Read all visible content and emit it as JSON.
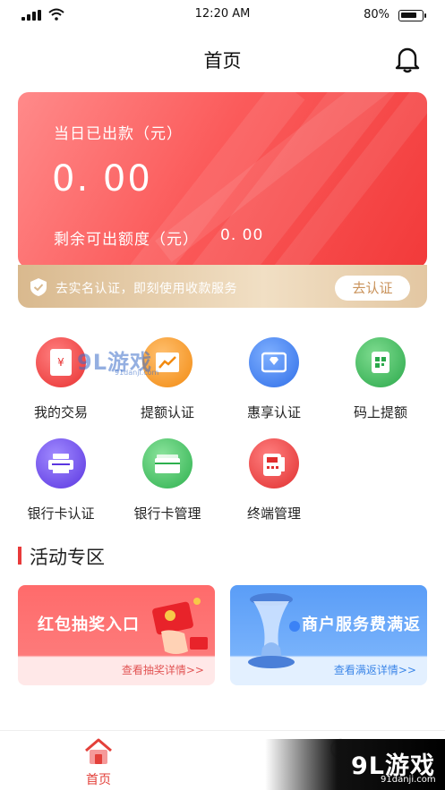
{
  "status_bar": {
    "time": "12:20 AM",
    "battery": "80%",
    "battery_level": 0.8
  },
  "nav": {
    "title": "首页"
  },
  "card": {
    "today_label": "当日已出款（元）",
    "today_amount": "0. 00",
    "remaining_label": "剩余可出额度（元）",
    "remaining_amount": "0. 00",
    "auth_text": "去实名认证，即刻使用收款服务",
    "auth_button": "去认证"
  },
  "grid": [
    {
      "label": "我的交易",
      "icon": "transaction-icon",
      "color": "#f24a4a"
    },
    {
      "label": "提额认证",
      "icon": "chart-up-icon",
      "color": "#f7941e"
    },
    {
      "label": "惠享认证",
      "icon": "diamond-badge-icon",
      "color": "#3b7cf2"
    },
    {
      "label": "码上提额",
      "icon": "qr-code-icon",
      "color": "#36b555"
    },
    {
      "label": "银行卡认证",
      "icon": "card-reader-icon",
      "color": "#6a47e6"
    },
    {
      "label": "银行卡管理",
      "icon": "bank-card-icon",
      "color": "#3cbd5c"
    },
    {
      "label": "终端管理",
      "icon": "pos-terminal-icon",
      "color": "#ec3d3d"
    }
  ],
  "section": {
    "title": "活动专区"
  },
  "activities": [
    {
      "title": "红包抽奖入口",
      "link": "查看抽奖详情>>"
    },
    {
      "title": "商户服务费满返",
      "link": "查看满返详情>>"
    }
  ],
  "tabbar": {
    "home": "首页"
  },
  "watermarks": {
    "top": "9L游戏",
    "top_sub": "91danji.com",
    "bottom": "9L游戏",
    "bottom_sub": "91danji.com"
  }
}
